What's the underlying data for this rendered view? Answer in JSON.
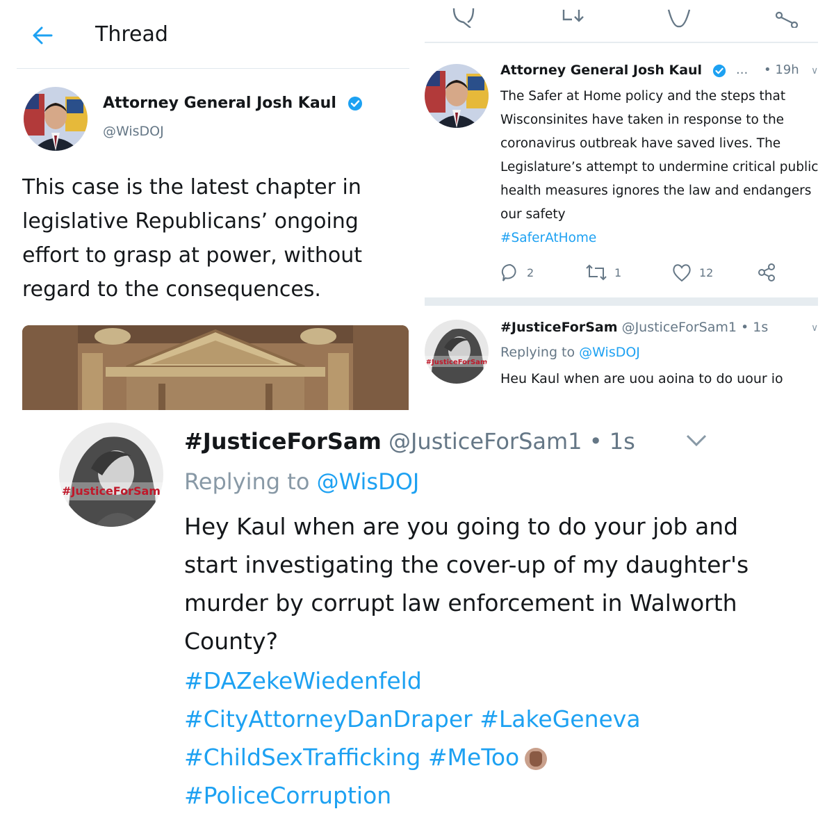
{
  "thread": {
    "title": "Thread",
    "author": "Attorney General Josh Kaul",
    "handle": "@WisDOJ",
    "text": "This case is the latest chapter in legislative Republicans’ ongoing effort to grasp at power, without regard to the consequences."
  },
  "tweet2": {
    "author": "Attorney General Josh Kaul",
    "more": "...",
    "time": "• 19h",
    "text": "The Safer at Home policy and the steps that Wisconsinites have taken in response to the coronavirus outbreak have saved lives. The Legislature’s attempt to undermine critical public health measures ignores the law and endangers our safety",
    "hashtag": "#SaferAtHome",
    "actions": {
      "replies": "2",
      "retweets": "1",
      "likes": "12"
    }
  },
  "reply_small": {
    "name": "#JusticeForSam",
    "handle": "@JusticeForSam1",
    "time": "• 1s",
    "replying_prefix": "Replying to",
    "replying_to": "@WisDOJ",
    "text_preview": "Heu Kaul when are uou aoina to do uour io"
  },
  "reply_large": {
    "name": "#JusticeForSam",
    "handle": "@JusticeForSam1",
    "time": "• 1s",
    "replying_prefix": "Replying to",
    "replying_to": "@WisDOJ",
    "text": "Hey Kaul when are you going to do your job and start investigating the cover-up of my daughter's murder by corrupt law enforcement in Walworth County?",
    "tag1": "#DAZekeWiedenfeld",
    "tag2": "#CityAttorneyDanDraper",
    "tag3": "#LakeGeneva",
    "tag4": "#ChildSexTrafficking",
    "tag5": "#MeToo",
    "tag6": "#PoliceCorruption",
    "avatar_watermark": "#JusticeForSam"
  },
  "colors": {
    "link": "#1da1f2",
    "muted": "#657786",
    "divider": "#e6ecf0"
  }
}
